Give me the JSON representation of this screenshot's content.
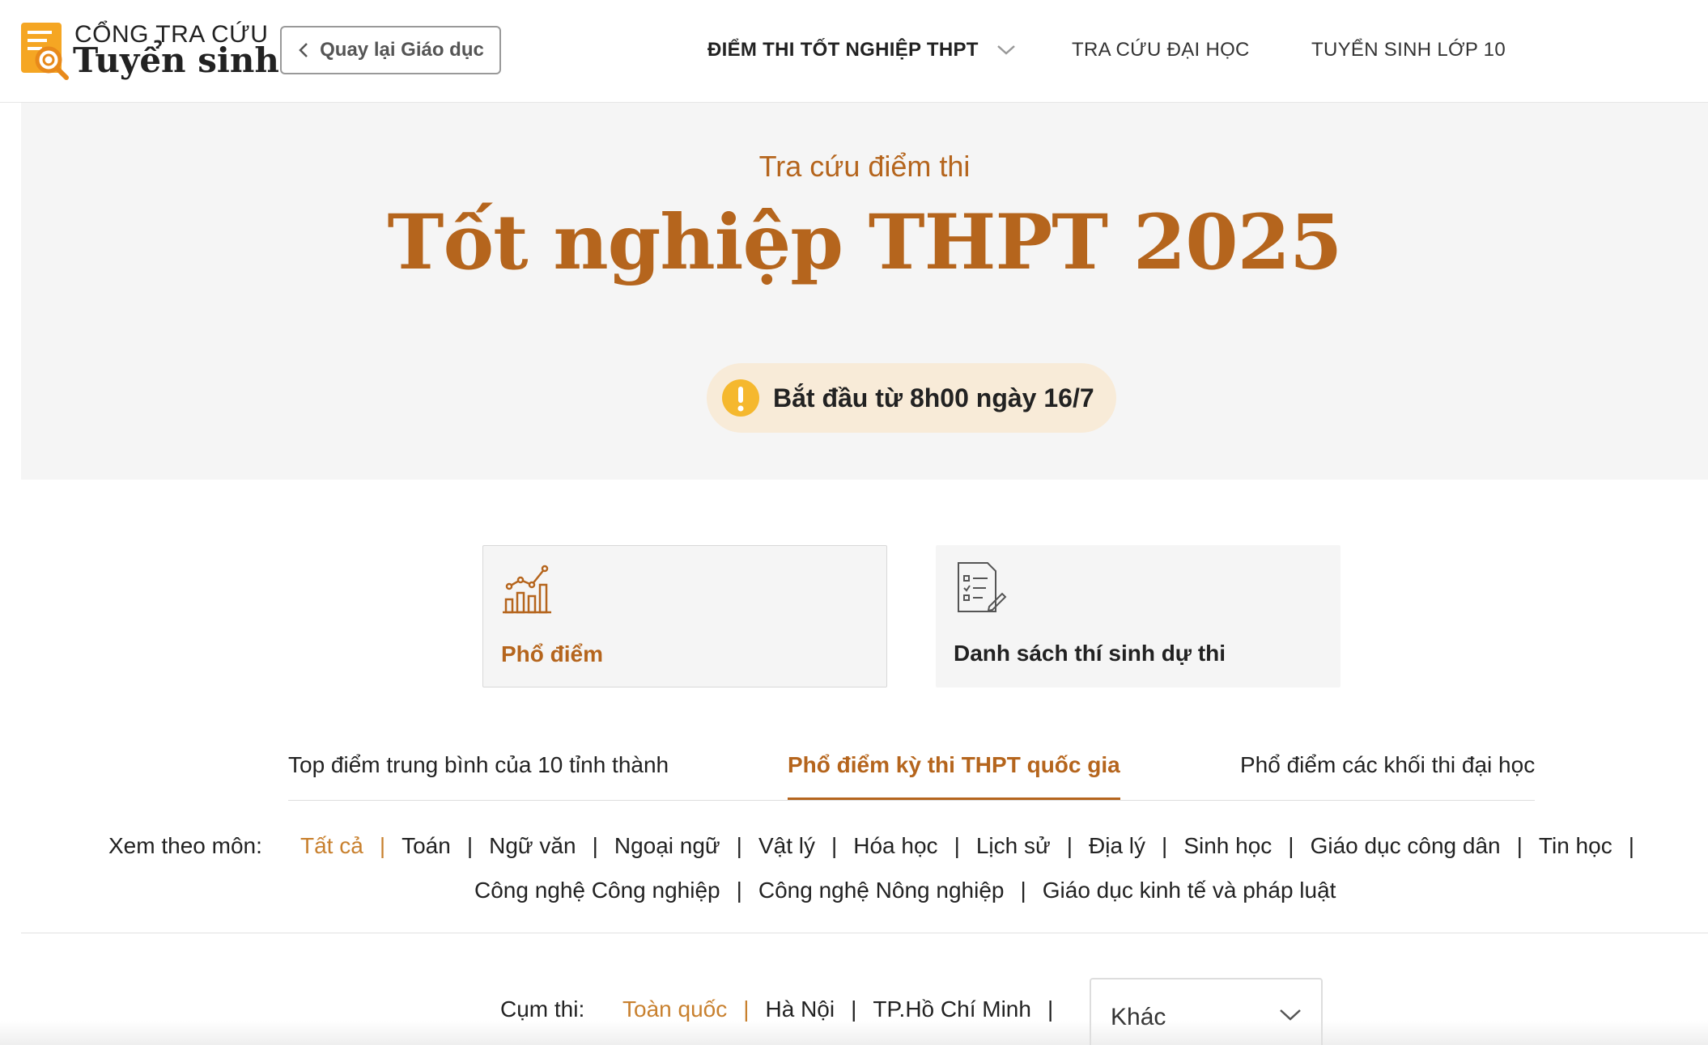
{
  "logo": {
    "line1": "CỔNG TRA CỨU",
    "line2": "Tuyển sinh"
  },
  "header": {
    "back_label": "Quay lại Giáo dục",
    "nav": [
      {
        "label": "ĐIỂM THI TỐT NGHIỆP THPT"
      },
      {
        "label": "TRA CỨU ĐẠI HỌC"
      },
      {
        "label": "TUYỂN SINH LỚP 10"
      }
    ]
  },
  "hero": {
    "subtitle": "Tra cứu điểm thi",
    "title": "Tốt nghiệp THPT 2025",
    "notice": "Bắt đầu từ 8h00 ngày 16/7"
  },
  "cards": [
    {
      "label": "Phổ điểm"
    },
    {
      "label": "Danh sách thí sinh dự thi"
    }
  ],
  "tabs": [
    {
      "label": "Top điểm trung bình của 10 tỉnh thành"
    },
    {
      "label": "Phổ điểm kỳ thi THPT quốc gia"
    },
    {
      "label": "Phổ điểm các khối thi đại học"
    }
  ],
  "subjects": {
    "label": "Xem theo môn:",
    "row1": [
      "Tất cả",
      "Toán",
      "Ngữ văn",
      "Ngoại ngữ",
      "Vật lý",
      "Hóa học",
      "Lịch sử",
      "Địa lý",
      "Sinh học",
      "Giáo dục công dân",
      "Tin học"
    ],
    "row2": [
      "Công nghệ Công nghiệp",
      "Công nghệ Nông nghiệp",
      "Giáo dục kinh tế và pháp luật"
    ],
    "separator": "|"
  },
  "region": {
    "label": "Cụm thi:",
    "items": [
      "Toàn quốc",
      "Hà Nội",
      "TP.Hồ Chí Minh"
    ],
    "select_value": "Khác"
  },
  "colors": {
    "accent": "#b5651d",
    "accent_light": "#c8802e",
    "notice_bg": "#f8ebd8",
    "warning": "#f5b82e"
  }
}
